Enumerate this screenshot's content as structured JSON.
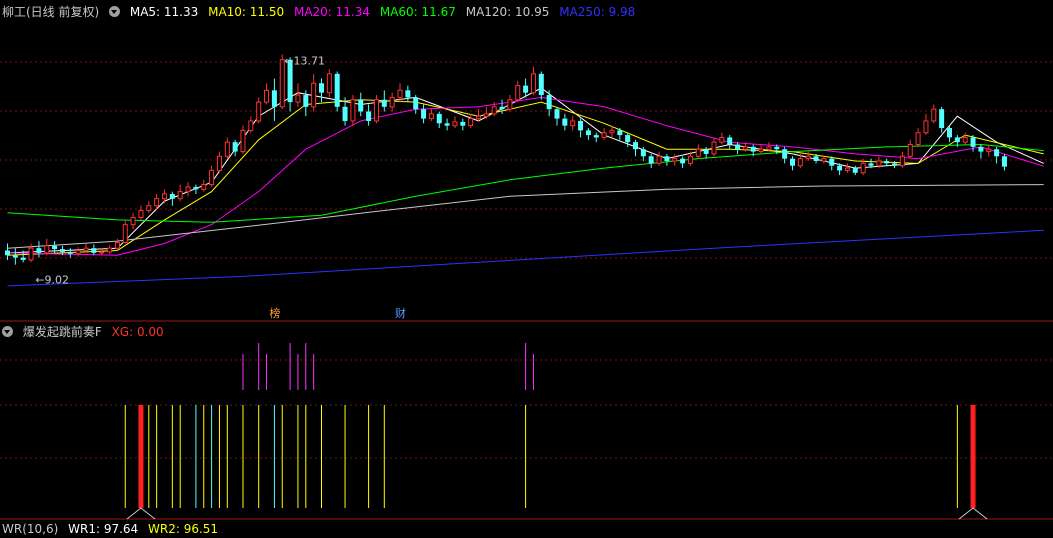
{
  "title": "柳工(日线 前复权)",
  "ma_legend": [
    {
      "label": "MA5: 11.33",
      "color": "#ffffff"
    },
    {
      "label": "MA10: 11.50",
      "color": "#ffff00"
    },
    {
      "label": "MA20: 11.34",
      "color": "#ff00ff"
    },
    {
      "label": "MA60: 11.67",
      "color": "#00ff00"
    },
    {
      "label": "MA120: 10.95",
      "color": "#c8c8c8"
    },
    {
      "label": "MA250: 9.98",
      "color": "#3030ff"
    }
  ],
  "indicator": {
    "name": "爆发起跳前奏F",
    "value_label": "XG: 0.00",
    "value_color": "#ff3030"
  },
  "bottom_legend": [
    {
      "label": "WR(10,6)",
      "color": "#c8c8c8"
    },
    {
      "label": "WR1: 97.64",
      "color": "#ffffff"
    },
    {
      "label": "WR2: 96.51",
      "color": "#ffff00"
    }
  ],
  "markers": [
    {
      "label": "榜",
      "index": 34,
      "color": "#ff9a30"
    },
    {
      "label": "财",
      "index": 50,
      "color": "#5a9aff"
    }
  ],
  "chart_data": {
    "type": "candlestick",
    "up_color": "#ff3030",
    "down_color": "#54ffff",
    "ylim": [
      8.5,
      14.4
    ],
    "high_annotation": "13.71",
    "low_annotation": "9.02",
    "candles": [
      [
        9.55,
        9.45,
        9.7,
        9.35
      ],
      [
        9.45,
        9.4,
        9.6,
        9.25
      ],
      [
        9.4,
        9.35,
        9.55,
        9.3
      ],
      [
        9.35,
        9.6,
        9.7,
        9.3
      ],
      [
        9.6,
        9.5,
        9.75,
        9.4
      ],
      [
        9.5,
        9.65,
        9.8,
        9.45
      ],
      [
        9.65,
        9.58,
        9.75,
        9.5
      ],
      [
        9.58,
        9.52,
        9.65,
        9.45
      ],
      [
        9.52,
        9.48,
        9.6,
        9.4
      ],
      [
        9.48,
        9.55,
        9.62,
        9.42
      ],
      [
        9.55,
        9.6,
        9.7,
        9.5
      ],
      [
        9.6,
        9.5,
        9.68,
        9.45
      ],
      [
        9.5,
        9.52,
        9.6,
        9.45
      ],
      [
        9.52,
        9.6,
        9.66,
        9.48
      ],
      [
        9.6,
        9.72,
        9.8,
        9.55
      ],
      [
        9.72,
        10.1,
        10.2,
        9.7
      ],
      [
        10.1,
        10.25,
        10.35,
        10.0
      ],
      [
        10.25,
        10.4,
        10.5,
        10.2
      ],
      [
        10.4,
        10.5,
        10.6,
        10.35
      ],
      [
        10.5,
        10.65,
        10.75,
        10.4
      ],
      [
        10.65,
        10.75,
        10.85,
        10.55
      ],
      [
        10.75,
        10.65,
        10.8,
        10.5
      ],
      [
        10.65,
        10.8,
        10.95,
        10.6
      ],
      [
        10.8,
        10.9,
        11.0,
        10.7
      ],
      [
        10.9,
        10.85,
        10.95,
        10.75
      ],
      [
        10.85,
        10.95,
        11.05,
        10.8
      ],
      [
        10.95,
        11.25,
        11.35,
        10.9
      ],
      [
        11.25,
        11.55,
        11.65,
        11.2
      ],
      [
        11.55,
        11.85,
        11.95,
        11.5
      ],
      [
        11.85,
        11.65,
        11.9,
        11.55
      ],
      [
        11.65,
        12.1,
        12.2,
        11.6
      ],
      [
        12.1,
        12.3,
        12.4,
        12.05
      ],
      [
        12.3,
        12.7,
        12.8,
        12.25
      ],
      [
        12.7,
        12.95,
        13.1,
        12.65
      ],
      [
        12.95,
        12.6,
        13.2,
        12.3
      ],
      [
        12.6,
        13.6,
        13.71,
        12.55
      ],
      [
        13.6,
        12.7,
        13.65,
        12.5
      ],
      [
        12.7,
        12.85,
        13.1,
        12.6
      ],
      [
        12.85,
        12.6,
        12.95,
        12.4
      ],
      [
        12.6,
        13.1,
        13.3,
        12.5
      ],
      [
        13.1,
        12.9,
        13.2,
        12.7
      ],
      [
        12.9,
        13.3,
        13.4,
        12.8
      ],
      [
        13.3,
        12.6,
        13.35,
        12.5
      ],
      [
        12.6,
        12.3,
        12.8,
        12.2
      ],
      [
        12.3,
        12.75,
        12.85,
        12.2
      ],
      [
        12.75,
        12.5,
        12.9,
        12.4
      ],
      [
        12.5,
        12.3,
        12.65,
        12.2
      ],
      [
        12.3,
        12.75,
        12.85,
        12.25
      ],
      [
        12.75,
        12.6,
        12.95,
        12.5
      ],
      [
        12.6,
        12.8,
        12.9,
        12.5
      ],
      [
        12.8,
        12.95,
        13.1,
        12.7
      ],
      [
        12.95,
        12.8,
        13.05,
        12.7
      ],
      [
        12.8,
        12.55,
        12.85,
        12.45
      ],
      [
        12.55,
        12.35,
        12.65,
        12.25
      ],
      [
        12.35,
        12.45,
        12.55,
        12.3
      ],
      [
        12.45,
        12.25,
        12.5,
        12.15
      ],
      [
        12.25,
        12.2,
        12.35,
        12.1
      ],
      [
        12.2,
        12.28,
        12.4,
        12.15
      ],
      [
        12.28,
        12.2,
        12.35,
        12.1
      ],
      [
        12.2,
        12.35,
        12.45,
        12.15
      ],
      [
        12.35,
        12.4,
        12.55,
        12.3
      ],
      [
        12.4,
        12.45,
        12.6,
        12.35
      ],
      [
        12.45,
        12.6,
        12.7,
        12.4
      ],
      [
        12.6,
        12.55,
        12.75,
        12.45
      ],
      [
        12.55,
        12.75,
        12.85,
        12.5
      ],
      [
        12.75,
        13.05,
        13.15,
        12.7
      ],
      [
        13.05,
        12.9,
        13.2,
        12.8
      ],
      [
        12.9,
        13.3,
        13.45,
        12.85
      ],
      [
        13.3,
        12.85,
        13.35,
        12.75
      ],
      [
        12.85,
        12.55,
        12.95,
        12.4
      ],
      [
        12.55,
        12.35,
        12.6,
        12.2
      ],
      [
        12.35,
        12.2,
        12.45,
        12.1
      ],
      [
        12.2,
        12.3,
        12.4,
        12.1
      ],
      [
        12.3,
        12.1,
        12.35,
        11.95
      ],
      [
        12.1,
        12.0,
        12.15,
        11.9
      ],
      [
        12.0,
        11.95,
        12.05,
        11.85
      ],
      [
        11.95,
        12.05,
        12.15,
        11.9
      ],
      [
        12.05,
        12.1,
        12.2,
        11.95
      ],
      [
        12.1,
        12.0,
        12.15,
        11.9
      ],
      [
        12.0,
        11.85,
        12.05,
        11.75
      ],
      [
        11.85,
        11.7,
        11.9,
        11.55
      ],
      [
        11.7,
        11.55,
        11.75,
        11.45
      ],
      [
        11.55,
        11.4,
        11.6,
        11.3
      ],
      [
        11.4,
        11.55,
        11.65,
        11.35
      ],
      [
        11.55,
        11.45,
        11.6,
        11.35
      ],
      [
        11.45,
        11.5,
        11.6,
        11.35
      ],
      [
        11.5,
        11.4,
        11.55,
        11.3
      ],
      [
        11.4,
        11.55,
        11.65,
        11.35
      ],
      [
        11.55,
        11.7,
        11.8,
        11.5
      ],
      [
        11.7,
        11.6,
        11.75,
        11.5
      ],
      [
        11.6,
        11.85,
        11.95,
        11.55
      ],
      [
        11.85,
        11.95,
        12.05,
        11.8
      ],
      [
        11.95,
        11.8,
        12.0,
        11.7
      ],
      [
        11.8,
        11.7,
        11.85,
        11.6
      ],
      [
        11.7,
        11.75,
        11.85,
        11.65
      ],
      [
        11.75,
        11.65,
        11.8,
        11.55
      ],
      [
        11.65,
        11.7,
        11.8,
        11.6
      ],
      [
        11.7,
        11.75,
        11.85,
        11.65
      ],
      [
        11.75,
        11.7,
        11.8,
        11.6
      ],
      [
        11.7,
        11.5,
        11.75,
        11.4
      ],
      [
        11.5,
        11.35,
        11.55,
        11.25
      ],
      [
        11.35,
        11.5,
        11.6,
        11.3
      ],
      [
        11.5,
        11.55,
        11.65,
        11.45
      ],
      [
        11.55,
        11.45,
        11.6,
        11.4
      ],
      [
        11.45,
        11.5,
        11.55,
        11.4
      ],
      [
        11.5,
        11.35,
        11.55,
        11.25
      ],
      [
        11.35,
        11.25,
        11.4,
        11.15
      ],
      [
        11.25,
        11.3,
        11.4,
        11.2
      ],
      [
        11.3,
        11.2,
        11.35,
        11.15
      ],
      [
        11.2,
        11.4,
        11.5,
        11.15
      ],
      [
        11.4,
        11.35,
        11.5,
        11.3
      ],
      [
        11.35,
        11.45,
        11.55,
        11.3
      ],
      [
        11.45,
        11.4,
        11.5,
        11.35
      ],
      [
        11.4,
        11.35,
        11.45,
        11.3
      ],
      [
        11.35,
        11.55,
        11.65,
        11.3
      ],
      [
        11.55,
        11.8,
        11.9,
        11.5
      ],
      [
        11.8,
        12.05,
        12.15,
        11.75
      ],
      [
        12.05,
        12.3,
        12.45,
        12.0
      ],
      [
        12.3,
        12.55,
        12.65,
        12.25
      ],
      [
        12.55,
        12.15,
        12.6,
        12.05
      ],
      [
        12.15,
        11.95,
        12.2,
        11.85
      ],
      [
        11.95,
        11.85,
        12.0,
        11.75
      ],
      [
        11.85,
        11.95,
        12.05,
        11.8
      ],
      [
        11.95,
        11.75,
        12.0,
        11.65
      ],
      [
        11.75,
        11.65,
        11.8,
        11.5
      ],
      [
        11.65,
        11.7,
        11.8,
        11.55
      ],
      [
        11.7,
        11.55,
        11.75,
        11.4
      ],
      [
        11.55,
        11.33,
        11.6,
        11.25
      ]
    ],
    "ma_series": [
      {
        "color": "#ffffff",
        "values": [
          [
            0,
            9.5
          ],
          [
            14,
            9.6
          ],
          [
            20,
            10.6
          ],
          [
            26,
            11.0
          ],
          [
            32,
            12.4
          ],
          [
            37,
            12.9
          ],
          [
            45,
            12.65
          ],
          [
            52,
            12.8
          ],
          [
            60,
            12.3
          ],
          [
            68,
            13.0
          ],
          [
            76,
            12.0
          ],
          [
            84,
            11.5
          ],
          [
            92,
            11.8
          ],
          [
            100,
            11.6
          ],
          [
            108,
            11.3
          ],
          [
            116,
            11.4
          ],
          [
            121,
            12.4
          ],
          [
            126,
            11.85
          ],
          [
            132,
            11.4
          ]
        ]
      },
      {
        "color": "#ffff00",
        "values": [
          [
            0,
            9.45
          ],
          [
            14,
            9.55
          ],
          [
            20,
            10.2
          ],
          [
            26,
            10.8
          ],
          [
            32,
            11.9
          ],
          [
            38,
            12.65
          ],
          [
            45,
            12.75
          ],
          [
            52,
            12.7
          ],
          [
            60,
            12.4
          ],
          [
            68,
            12.7
          ],
          [
            76,
            12.25
          ],
          [
            84,
            11.7
          ],
          [
            92,
            11.7
          ],
          [
            100,
            11.65
          ],
          [
            108,
            11.45
          ],
          [
            116,
            11.4
          ],
          [
            122,
            12.0
          ],
          [
            132,
            11.6
          ]
        ]
      },
      {
        "color": "#ff00ff",
        "values": [
          [
            0,
            9.5
          ],
          [
            14,
            9.45
          ],
          [
            20,
            9.7
          ],
          [
            26,
            10.1
          ],
          [
            32,
            10.8
          ],
          [
            38,
            11.7
          ],
          [
            45,
            12.3
          ],
          [
            52,
            12.55
          ],
          [
            60,
            12.6
          ],
          [
            68,
            12.8
          ],
          [
            76,
            12.6
          ],
          [
            84,
            12.2
          ],
          [
            92,
            11.85
          ],
          [
            100,
            11.75
          ],
          [
            108,
            11.6
          ],
          [
            116,
            11.5
          ],
          [
            124,
            11.75
          ],
          [
            132,
            11.34
          ]
        ]
      },
      {
        "color": "#00ff00",
        "values": [
          [
            0,
            10.35
          ],
          [
            14,
            10.2
          ],
          [
            26,
            10.15
          ],
          [
            40,
            10.3
          ],
          [
            52,
            10.7
          ],
          [
            64,
            11.05
          ],
          [
            76,
            11.3
          ],
          [
            88,
            11.5
          ],
          [
            100,
            11.65
          ],
          [
            112,
            11.75
          ],
          [
            124,
            11.8
          ],
          [
            132,
            11.67
          ]
        ]
      },
      {
        "color": "#c8c8c8",
        "values": [
          [
            0,
            9.6
          ],
          [
            14,
            9.75
          ],
          [
            30,
            10.05
          ],
          [
            48,
            10.4
          ],
          [
            64,
            10.7
          ],
          [
            84,
            10.85
          ],
          [
            104,
            10.92
          ],
          [
            132,
            10.95
          ]
        ]
      },
      {
        "color": "#3030ff",
        "values": [
          [
            0,
            8.8
          ],
          [
            30,
            9.0
          ],
          [
            60,
            9.3
          ],
          [
            90,
            9.6
          ],
          [
            112,
            9.8
          ],
          [
            132,
            9.98
          ]
        ]
      }
    ],
    "xg_signals": [
      30,
      32,
      33,
      36,
      37,
      38,
      39,
      66,
      67
    ],
    "bottom_signals": [
      {
        "index": 15,
        "color": "#ffff00",
        "strong": false
      },
      {
        "index": 17,
        "color": "#ff2020",
        "strong": true
      },
      {
        "index": 18,
        "color": "#ffff00",
        "strong": false
      },
      {
        "index": 19,
        "color": "#ffff00",
        "strong": false
      },
      {
        "index": 21,
        "color": "#ffff00",
        "strong": false
      },
      {
        "index": 22,
        "color": "#ffff00",
        "strong": false
      },
      {
        "index": 24,
        "color": "#54ffff",
        "strong": false
      },
      {
        "index": 25,
        "color": "#ffff00",
        "strong": false
      },
      {
        "index": 26,
        "color": "#54ffff",
        "strong": false
      },
      {
        "index": 27,
        "color": "#ffff00",
        "strong": false
      },
      {
        "index": 28,
        "color": "#ffff00",
        "strong": false
      },
      {
        "index": 30,
        "color": "#ffff00",
        "strong": false
      },
      {
        "index": 32,
        "color": "#ffff00",
        "strong": false
      },
      {
        "index": 34,
        "color": "#54ffff",
        "strong": false
      },
      {
        "index": 35,
        "color": "#ffff00",
        "strong": false
      },
      {
        "index": 37,
        "color": "#ffff00",
        "strong": false
      },
      {
        "index": 38,
        "color": "#ffff00",
        "strong": false
      },
      {
        "index": 40,
        "color": "#ffff00",
        "strong": false
      },
      {
        "index": 43,
        "color": "#ffff00",
        "strong": false
      },
      {
        "index": 46,
        "color": "#ffff00",
        "strong": false
      },
      {
        "index": 48,
        "color": "#ffff00",
        "strong": false
      },
      {
        "index": 66,
        "color": "#ffff00",
        "strong": false
      },
      {
        "index": 121,
        "color": "#ffff00",
        "strong": false
      },
      {
        "index": 123,
        "color": "#ff2020",
        "strong": true
      }
    ]
  }
}
